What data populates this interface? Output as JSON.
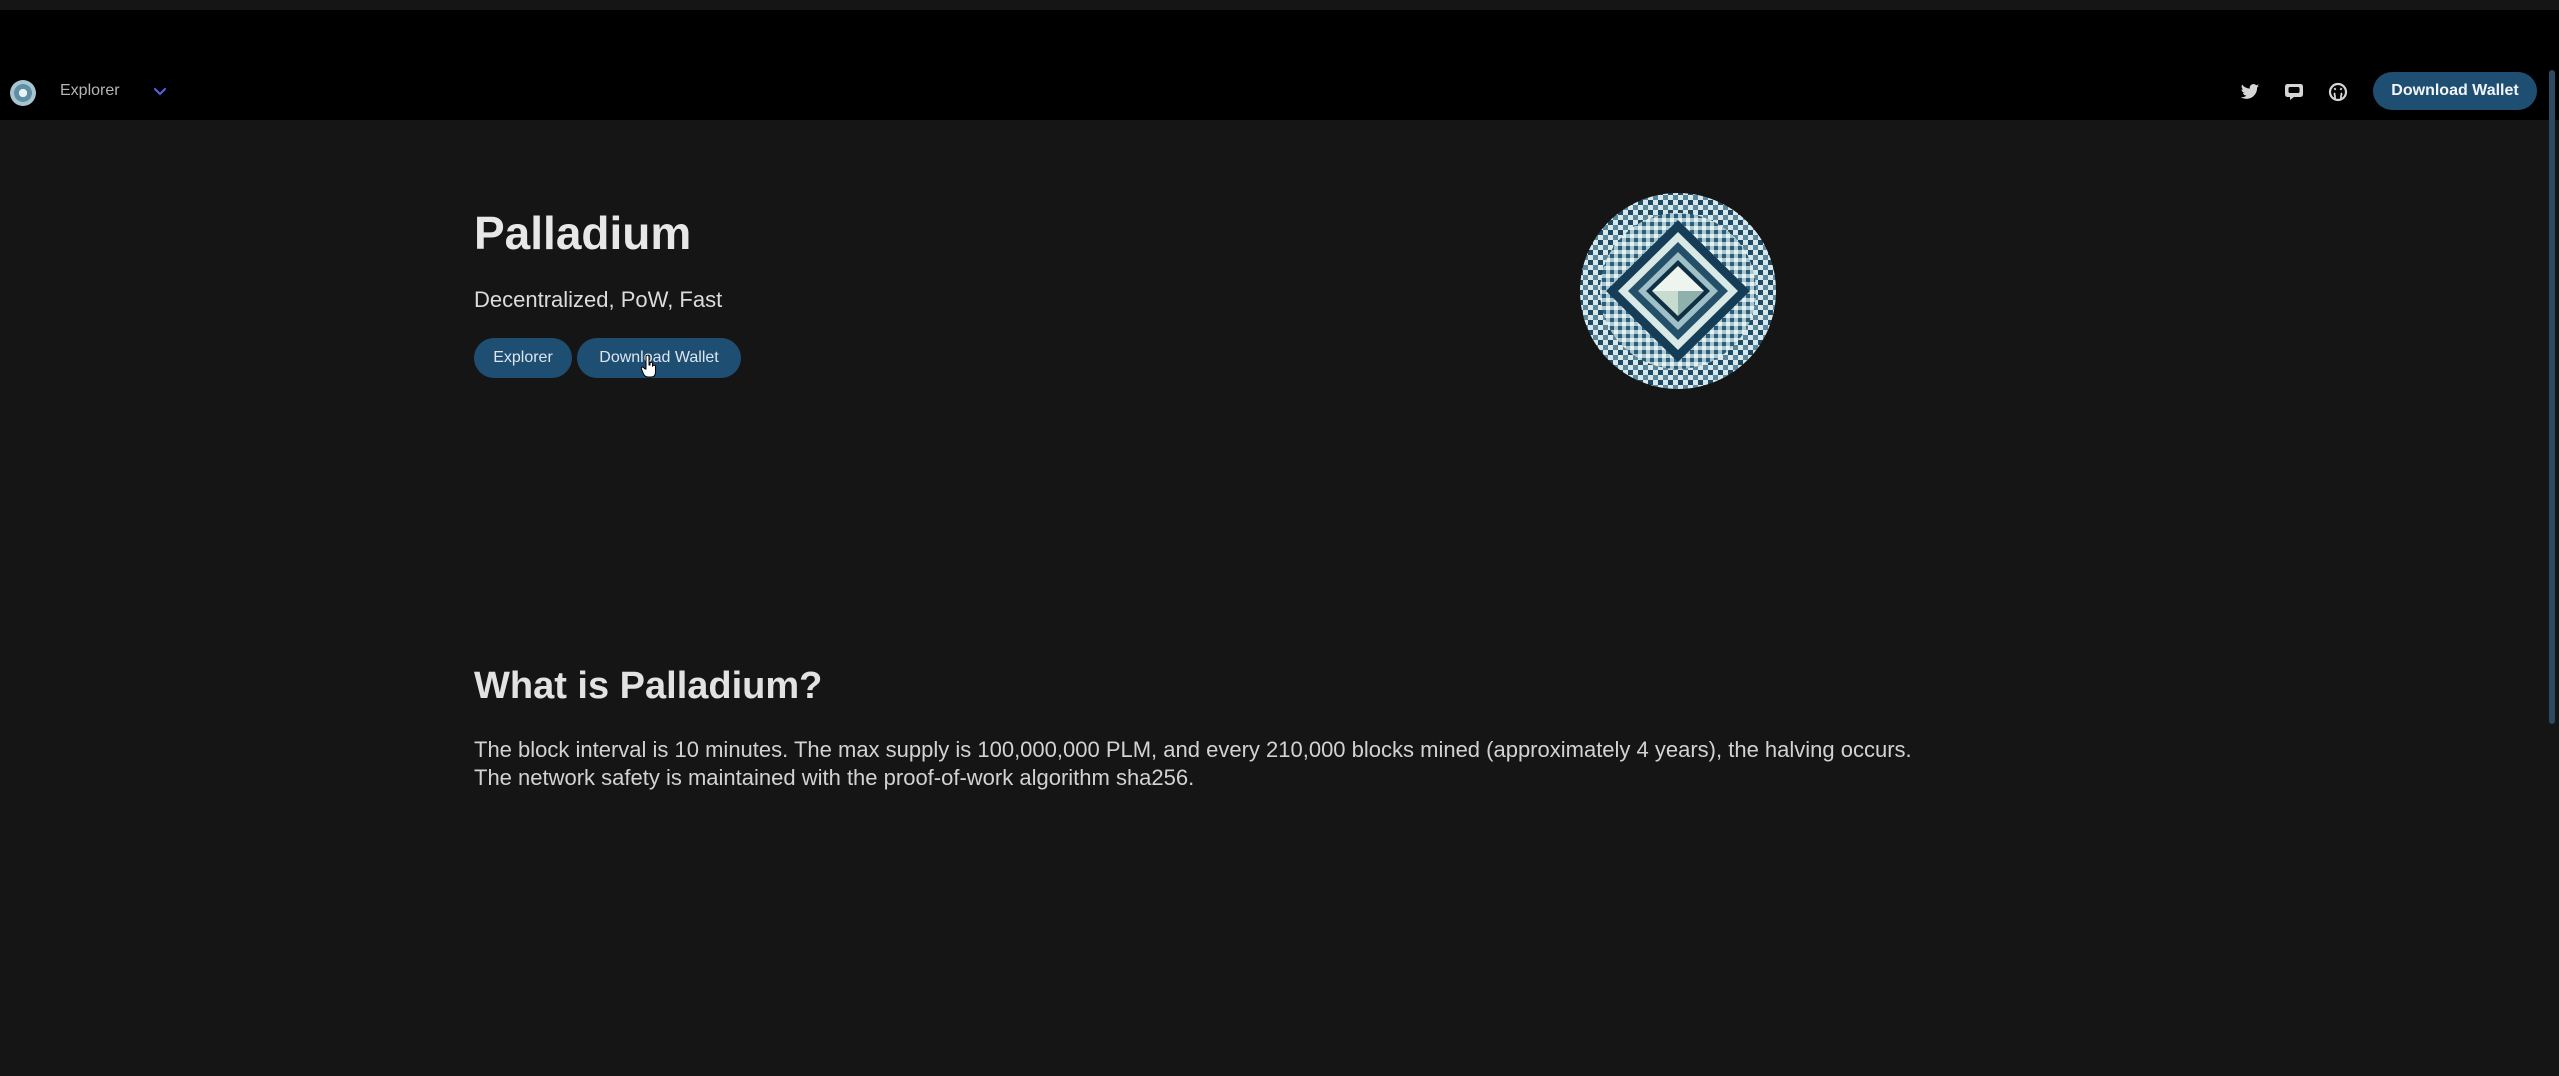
{
  "nav": {
    "explorer_label": "Explorer",
    "download_label": "Download Wallet",
    "social_icons": [
      "twitter-icon",
      "discord-icon",
      "github-icon"
    ]
  },
  "hero": {
    "title": "Palladium",
    "subtitle": "Decentralized, PoW, Fast",
    "explorer_button": "Explorer",
    "download_button": "Download Wallet"
  },
  "about": {
    "title": "What is Palladium?",
    "line1": "The block interval is 10 minutes. The max supply is 100,000,000 PLM, and every 210,000 blocks mined (approximately 4 years), the halving occurs.",
    "line2": "The network safety is maintained with the proof-of-work algorithm sha256."
  },
  "colors": {
    "background": "#151515",
    "navbar": "#000000",
    "button": "#1f4e73",
    "chevron_accent": "#5b5bd6"
  }
}
